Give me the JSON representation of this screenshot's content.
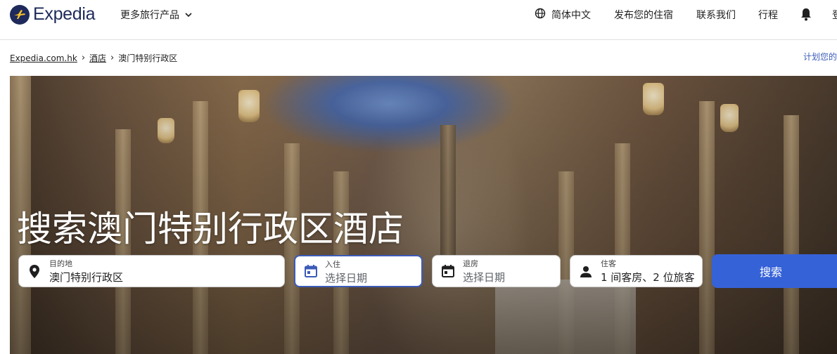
{
  "header": {
    "brand": "Expedia",
    "more_travel": "更多旅行产品",
    "language": "简体中文",
    "list_property": "发布您的住宿",
    "contact": "联系我们",
    "trips": "行程",
    "sign_in": "登"
  },
  "breadcrumb": {
    "items": [
      "Expedia.com.hk",
      "酒店",
      "澳门特别行政区"
    ],
    "plan_link": "计划您的"
  },
  "hero": {
    "title": "搜索澳门特别行政区酒店"
  },
  "search": {
    "destination": {
      "label": "目的地",
      "value": "澳门特别行政区"
    },
    "check_in": {
      "label": "入住",
      "placeholder": "选择日期"
    },
    "check_out": {
      "label": "退房",
      "placeholder": "选择日期"
    },
    "guests": {
      "label": "住客",
      "value": "1 间客房、2 位旅客"
    },
    "submit": "搜索"
  },
  "colors": {
    "brand_navy": "#1e2a5b",
    "accent_blue": "#3662d8",
    "link_blue": "#3b5bb9"
  },
  "icons": [
    "expedia-logo-icon",
    "chevron-down-icon",
    "globe-icon",
    "bell-icon",
    "location-pin-icon",
    "calendar-icon",
    "person-icon"
  ]
}
